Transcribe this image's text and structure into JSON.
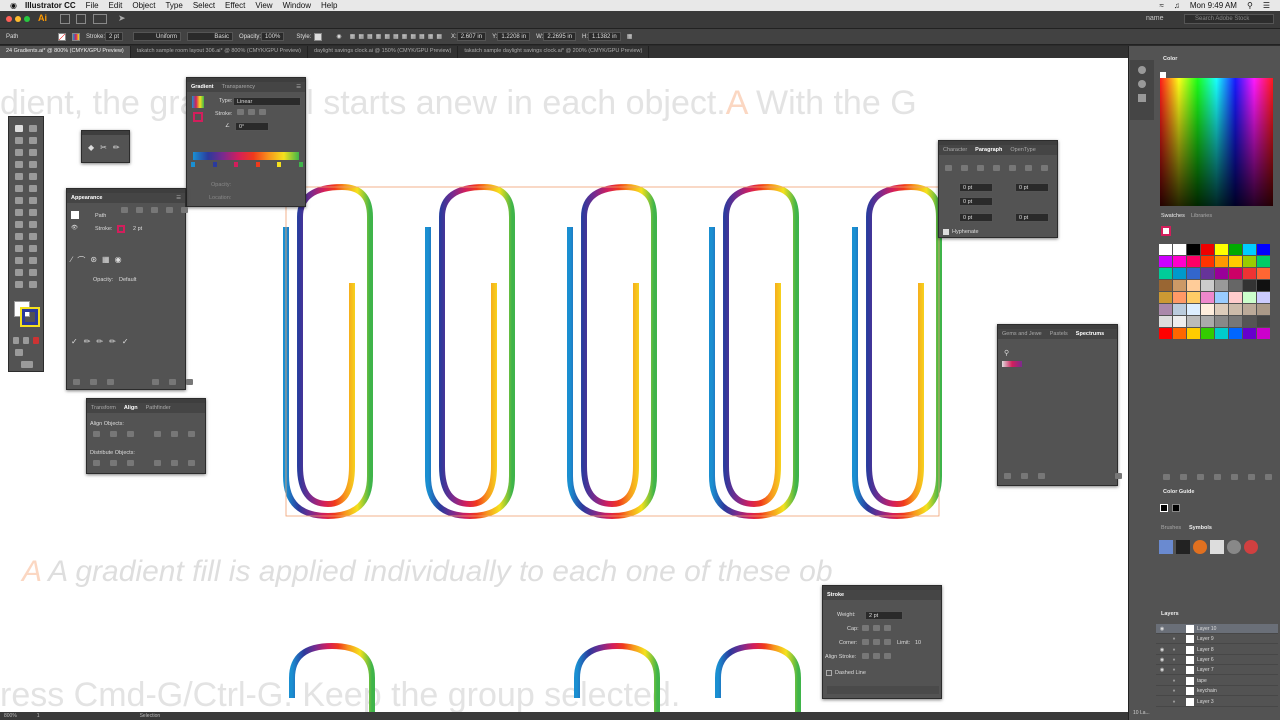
{
  "menubar": {
    "app_name": "Illustrator CC",
    "items": [
      "File",
      "Edit",
      "Object",
      "Type",
      "Select",
      "Effect",
      "View",
      "Window",
      "Help"
    ],
    "clock": "Mon 9:49 AM"
  },
  "appbar": {
    "workspace": "name",
    "search_placeholder": "Search Adobe Stock"
  },
  "control": {
    "selection_label": "Path",
    "stroke_label": "Stroke:",
    "stroke_value": "2 pt",
    "profile_label": "Uniform",
    "brush_label": "Basic",
    "opacity_label": "Opacity:",
    "opacity_value": "100%",
    "style_label": "Style:",
    "x_label": "X:",
    "x_value": "2.607 in",
    "y_label": "Y:",
    "y_value": "1.2208 in",
    "w_label": "W:",
    "w_value": "2.2695 in",
    "h_label": "H:",
    "h_value": "1.1382 in"
  },
  "tabs": [
    "24 Gradients.ai* @ 800% (CMYK/GPU Preview)",
    "takatch sample room layout 306.ai* @ 800% (CMYK/GPU Preview)",
    "daylight savings clock.ai @ 150% (CMYK/GPU Preview)",
    "takatch sample daylight savings clock.ai* @ 200% (CMYK/GPU Preview)"
  ],
  "canvas": {
    "line1": "dient, the gradient fill starts anew in each object.",
    "line1_marker": "A",
    "line1_tail": "With the G",
    "line2_marker": "A",
    "line2": "A gradient fill is applied individually to each one of these ob",
    "line3": "ress Cmd-G/Ctrl-G. Keep the group selected."
  },
  "gradient_panel": {
    "tab1": "Gradient",
    "tab2": "Transparency",
    "type_label": "Type:",
    "type_value": "Linear",
    "stroke_label": "Stroke:",
    "angle_value": "0°",
    "opacity_label": "Opacity:",
    "location_label": "Location:"
  },
  "appearance_panel": {
    "title": "Appearance",
    "path_label": "Path",
    "stroke_label": "Stroke:",
    "stroke_value": "2 pt",
    "opacity_label": "Opacity:",
    "opacity_value": "Default"
  },
  "align_panel": {
    "tab1": "Transform",
    "tab2": "Align",
    "tab3": "Pathfinder",
    "align_objects": "Align Objects:",
    "distribute_objects": "Distribute Objects:"
  },
  "paragraph_panel": {
    "tab1": "Character",
    "tab2": "Paragraph",
    "tab3": "OpenType",
    "indent_left": "0 pt",
    "indent_right": "0 pt",
    "first_line": "0 pt",
    "space_before": "0 pt",
    "space_after": "0 pt",
    "hyphenate": "Hyphenate"
  },
  "swatch_lib_panel": {
    "tab1": "Gems and Jewe",
    "tab2": "Pastels",
    "tab3": "Spectrums"
  },
  "stroke_panel": {
    "title": "Stroke",
    "weight_label": "Weight:",
    "weight_value": "2 pt",
    "cap_label": "Cap:",
    "corner_label": "Corner:",
    "limit_label": "Limit:",
    "limit_value": "10",
    "align_label": "Align Stroke:",
    "dashed_label": "Dashed Line"
  },
  "right_dock": {
    "color_title": "Color",
    "swatches_tab": "Swatches",
    "libraries_tab": "Libraries",
    "color_guide_title": "Color Guide",
    "brushes_tab": "Brushes",
    "symbols_tab": "Symbols",
    "layers_title": "Layers",
    "layers": [
      "Layer 10",
      "Layer 9",
      "Layer 8",
      "Layer 6",
      "Layer 7",
      "tape",
      "keychain",
      "Layer 3"
    ],
    "layers_count": "10 La..."
  },
  "status": {
    "zoom": "800%",
    "page": "1",
    "tool": "Selection"
  },
  "colors": {
    "accent": "#ff9a00",
    "spectrum": [
      "#1a8fd1",
      "#2b3a9c",
      "#7b2a8e",
      "#d31e5c",
      "#f03a1c",
      "#f7941d",
      "#f5e11d",
      "#3fb44a"
    ]
  }
}
